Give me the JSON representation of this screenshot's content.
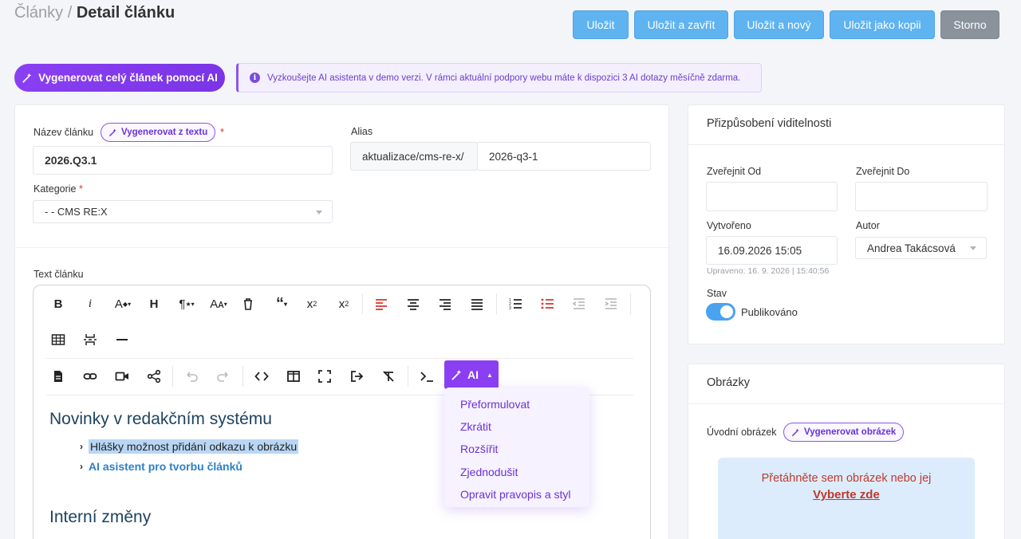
{
  "header": {
    "breadcrumb_parent": "Články",
    "breadcrumb_sep": "/",
    "breadcrumb_current": "Detail článku",
    "buttons": {
      "save": "Uložit",
      "save_close": "Uložit a zavřít",
      "save_new": "Uložit a nový",
      "save_copy": "Uložit jako kopii",
      "cancel": "Storno"
    }
  },
  "ai_generate_article": "Vygenerovat celý článek pomocí AI",
  "info_notice": "Vyzkoušejte AI asistenta v demo verzi. V rámci aktuální podpory webu máte k dispozici 3 AI dotazy měsíčně zdarma.",
  "article": {
    "title_label": "Název článku",
    "title_ai_button": "Vygenerovat z textu",
    "title_value": "2026.Q3.1",
    "alias_label": "Alias",
    "alias_prefix": "aktualizace/cms-re-x/",
    "alias_value": "2026-q3-1",
    "category_label": "Kategorie",
    "category_value": "- - CMS RE:X",
    "text_label": "Text článku",
    "required_mark": "*"
  },
  "editor": {
    "ai_button": "AI",
    "ai_menu": [
      "Přeformulovat",
      "Zkrátit",
      "Rozšířit",
      "Zjednodušit",
      "Opravit pravopis a styl"
    ],
    "content": {
      "heading1": "Novinky v redakčním systému",
      "bullet1": "Hlášky možnost přidání odkazu k obrázku",
      "bullet2": "AI asistent pro tvorbu článků",
      "heading2": "Interní změny"
    }
  },
  "visibility": {
    "title": "Přizpůsobení viditelnosti",
    "publish_from_label": "Zveřejnit Od",
    "publish_to_label": "Zveřejnit Do",
    "created_label": "Vytvořeno",
    "created_value": "16.09.2026 15:05",
    "modified_note": "Upraveno: 16. 9. 2026 | 15:40:56",
    "author_label": "Autor",
    "author_value": "Andrea Takácsová",
    "status_label": "Stav",
    "status_value": "Publikováno",
    "status_on": true
  },
  "images": {
    "title": "Obrázky",
    "intro_label": "Úvodní obrázek",
    "generate_button": "Vygenerovat obrázek",
    "drop_text": "Přetáhněte sem obrázek nebo jej",
    "drop_link": "Vyberte zde"
  },
  "colors": {
    "primary": "#5fb3f0",
    "ai_purple": "#8a3ff2",
    "heading_blue": "#1e4360",
    "link_red": "#c0392b",
    "selection": "#b9d7f5"
  }
}
